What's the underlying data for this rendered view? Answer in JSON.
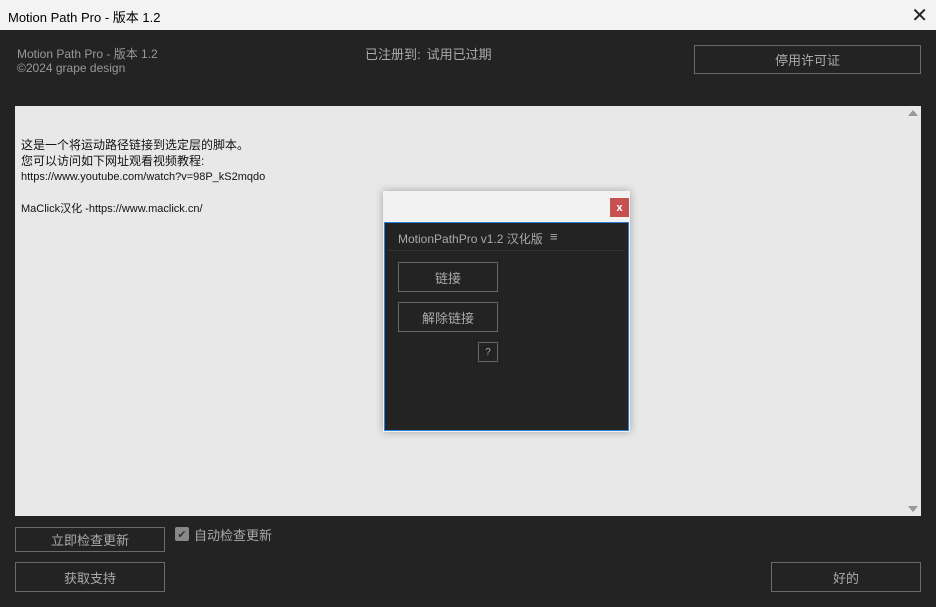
{
  "window": {
    "title": "Motion Path Pro - 版本 1.2",
    "close": "✕"
  },
  "header": {
    "product": "Motion Path Pro - 版本 1.2",
    "copyright": "©2024 grape design",
    "registered_label": "已注册到:",
    "registered_value": "试用已过期",
    "deactivate": "停用许可证"
  },
  "content": {
    "line1": "这是一个将运动路径链接到选定层的脚本。",
    "line2": "您可以访问如下网址观看视频教程:",
    "link": "https://www.youtube.com/watch?v=98P_kS2mqdo",
    "credit": "MaClick汉化 -https://www.maclick.cn/"
  },
  "dialog": {
    "close": "x",
    "title": "MotionPathPro v1.2 汉化版",
    "menu": "≡",
    "link": "链接",
    "unlink": "解除链接",
    "help": "?"
  },
  "footer": {
    "check_now": "立即检查更新",
    "auto_check": "自动检查更新",
    "auto_check_checked": true,
    "support": "获取支持",
    "ok": "好的"
  }
}
